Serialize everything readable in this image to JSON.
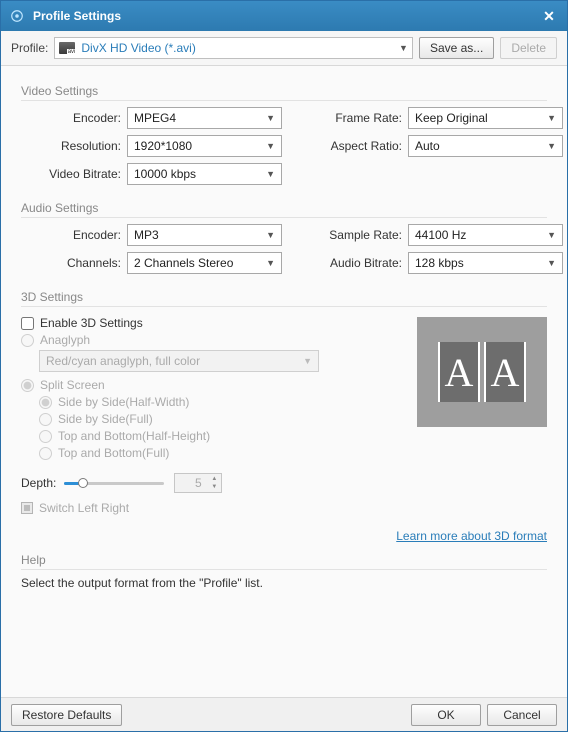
{
  "window": {
    "title": "Profile Settings"
  },
  "toolbar": {
    "profile_label": "Profile:",
    "profile_value": "DivX HD Video (*.avi)",
    "save_as": "Save as...",
    "delete": "Delete"
  },
  "video": {
    "group": "Video Settings",
    "encoder_label": "Encoder:",
    "encoder_value": "MPEG4",
    "framerate_label": "Frame Rate:",
    "framerate_value": "Keep Original",
    "resolution_label": "Resolution:",
    "resolution_value": "1920*1080",
    "aspect_label": "Aspect Ratio:",
    "aspect_value": "Auto",
    "vbitrate_label": "Video Bitrate:",
    "vbitrate_value": "10000 kbps"
  },
  "audio": {
    "group": "Audio Settings",
    "encoder_label": "Encoder:",
    "encoder_value": "MP3",
    "samplerate_label": "Sample Rate:",
    "samplerate_value": "44100 Hz",
    "channels_label": "Channels:",
    "channels_value": "2 Channels Stereo",
    "abitrate_label": "Audio Bitrate:",
    "abitrate_value": "128 kbps"
  },
  "threed": {
    "group": "3D Settings",
    "enable_label": "Enable 3D Settings",
    "anaglyph_label": "Anaglyph",
    "anaglyph_value": "Red/cyan anaglyph, full color",
    "split_label": "Split Screen",
    "sbs_hw": "Side by Side(Half-Width)",
    "sbs_full": "Side by Side(Full)",
    "tab_hh": "Top and Bottom(Half-Height)",
    "tab_full": "Top and Bottom(Full)",
    "depth_label": "Depth:",
    "depth_value": "5",
    "switch_label": "Switch Left Right",
    "learn_more": "Learn more about 3D format"
  },
  "help": {
    "group": "Help",
    "text": "Select the output format from the \"Profile\" list."
  },
  "footer": {
    "restore": "Restore Defaults",
    "ok": "OK",
    "cancel": "Cancel"
  }
}
